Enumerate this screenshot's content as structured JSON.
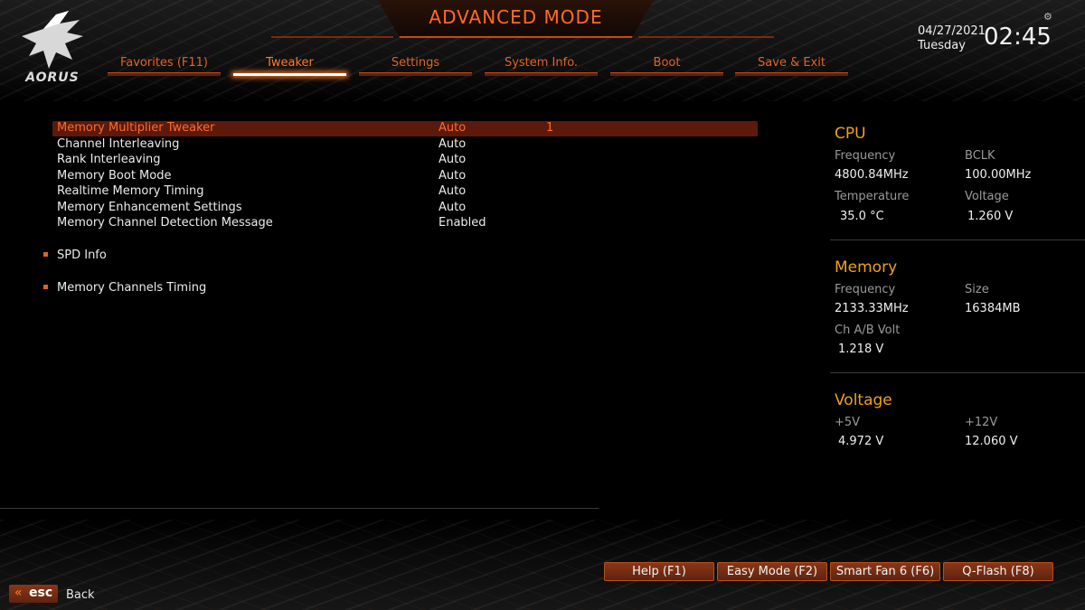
{
  "header": {
    "title": "ADVANCED MODE",
    "logo_text": "AORUS",
    "date": "04/27/2021",
    "day": "Tuesday",
    "time": "02:45"
  },
  "tabs": [
    {
      "label": "Favorites (F11)",
      "active": false
    },
    {
      "label": "Tweaker",
      "active": true
    },
    {
      "label": "Settings",
      "active": false
    },
    {
      "label": "System Info.",
      "active": false
    },
    {
      "label": "Boot",
      "active": false
    },
    {
      "label": "Save & Exit",
      "active": false
    }
  ],
  "settings": [
    {
      "label": "Memory Multiplier Tweaker",
      "value": "Auto",
      "value2": "1",
      "selected": true
    },
    {
      "label": "Channel Interleaving",
      "value": "Auto"
    },
    {
      "label": "Rank Interleaving",
      "value": "Auto"
    },
    {
      "label": "Memory Boot Mode",
      "value": "Auto"
    },
    {
      "label": "Realtime Memory Timing",
      "value": "Auto"
    },
    {
      "label": "Memory Enhancement Settings",
      "value": "Auto"
    },
    {
      "label": "Memory Channel Detection Message",
      "value": "Enabled"
    }
  ],
  "submenus": [
    {
      "label": "SPD Info"
    },
    {
      "label": "Memory Channels Timing"
    }
  ],
  "sidebar": {
    "cpu": {
      "title": "CPU",
      "frequency_label": "Frequency",
      "frequency_value": "4800.84MHz",
      "bclk_label": "BCLK",
      "bclk_value": "100.00MHz",
      "temperature_label": "Temperature",
      "temperature_value": "35.0 °C",
      "voltage_label": "Voltage",
      "voltage_value": "1.260 V"
    },
    "memory": {
      "title": "Memory",
      "frequency_label": "Frequency",
      "frequency_value": "2133.33MHz",
      "size_label": "Size",
      "size_value": "16384MB",
      "chvolt_label": "Ch A/B Volt",
      "chvolt_value": "1.218 V"
    },
    "voltage": {
      "title": "Voltage",
      "v5_label": "+5V",
      "v5_value": "4.972 V",
      "v12_label": "+12V",
      "v12_value": "12.060 V"
    }
  },
  "footer": {
    "buttons": [
      "Help (F1)",
      "Easy Mode (F2)",
      "Smart Fan 6 (F6)",
      "Q-Flash (F8)"
    ],
    "esc_label": "esc",
    "back_label": "Back"
  },
  "colors": {
    "accent": "#ff6a2a",
    "panel_title": "#f0a020",
    "selected_row": "#5c1a0c"
  }
}
